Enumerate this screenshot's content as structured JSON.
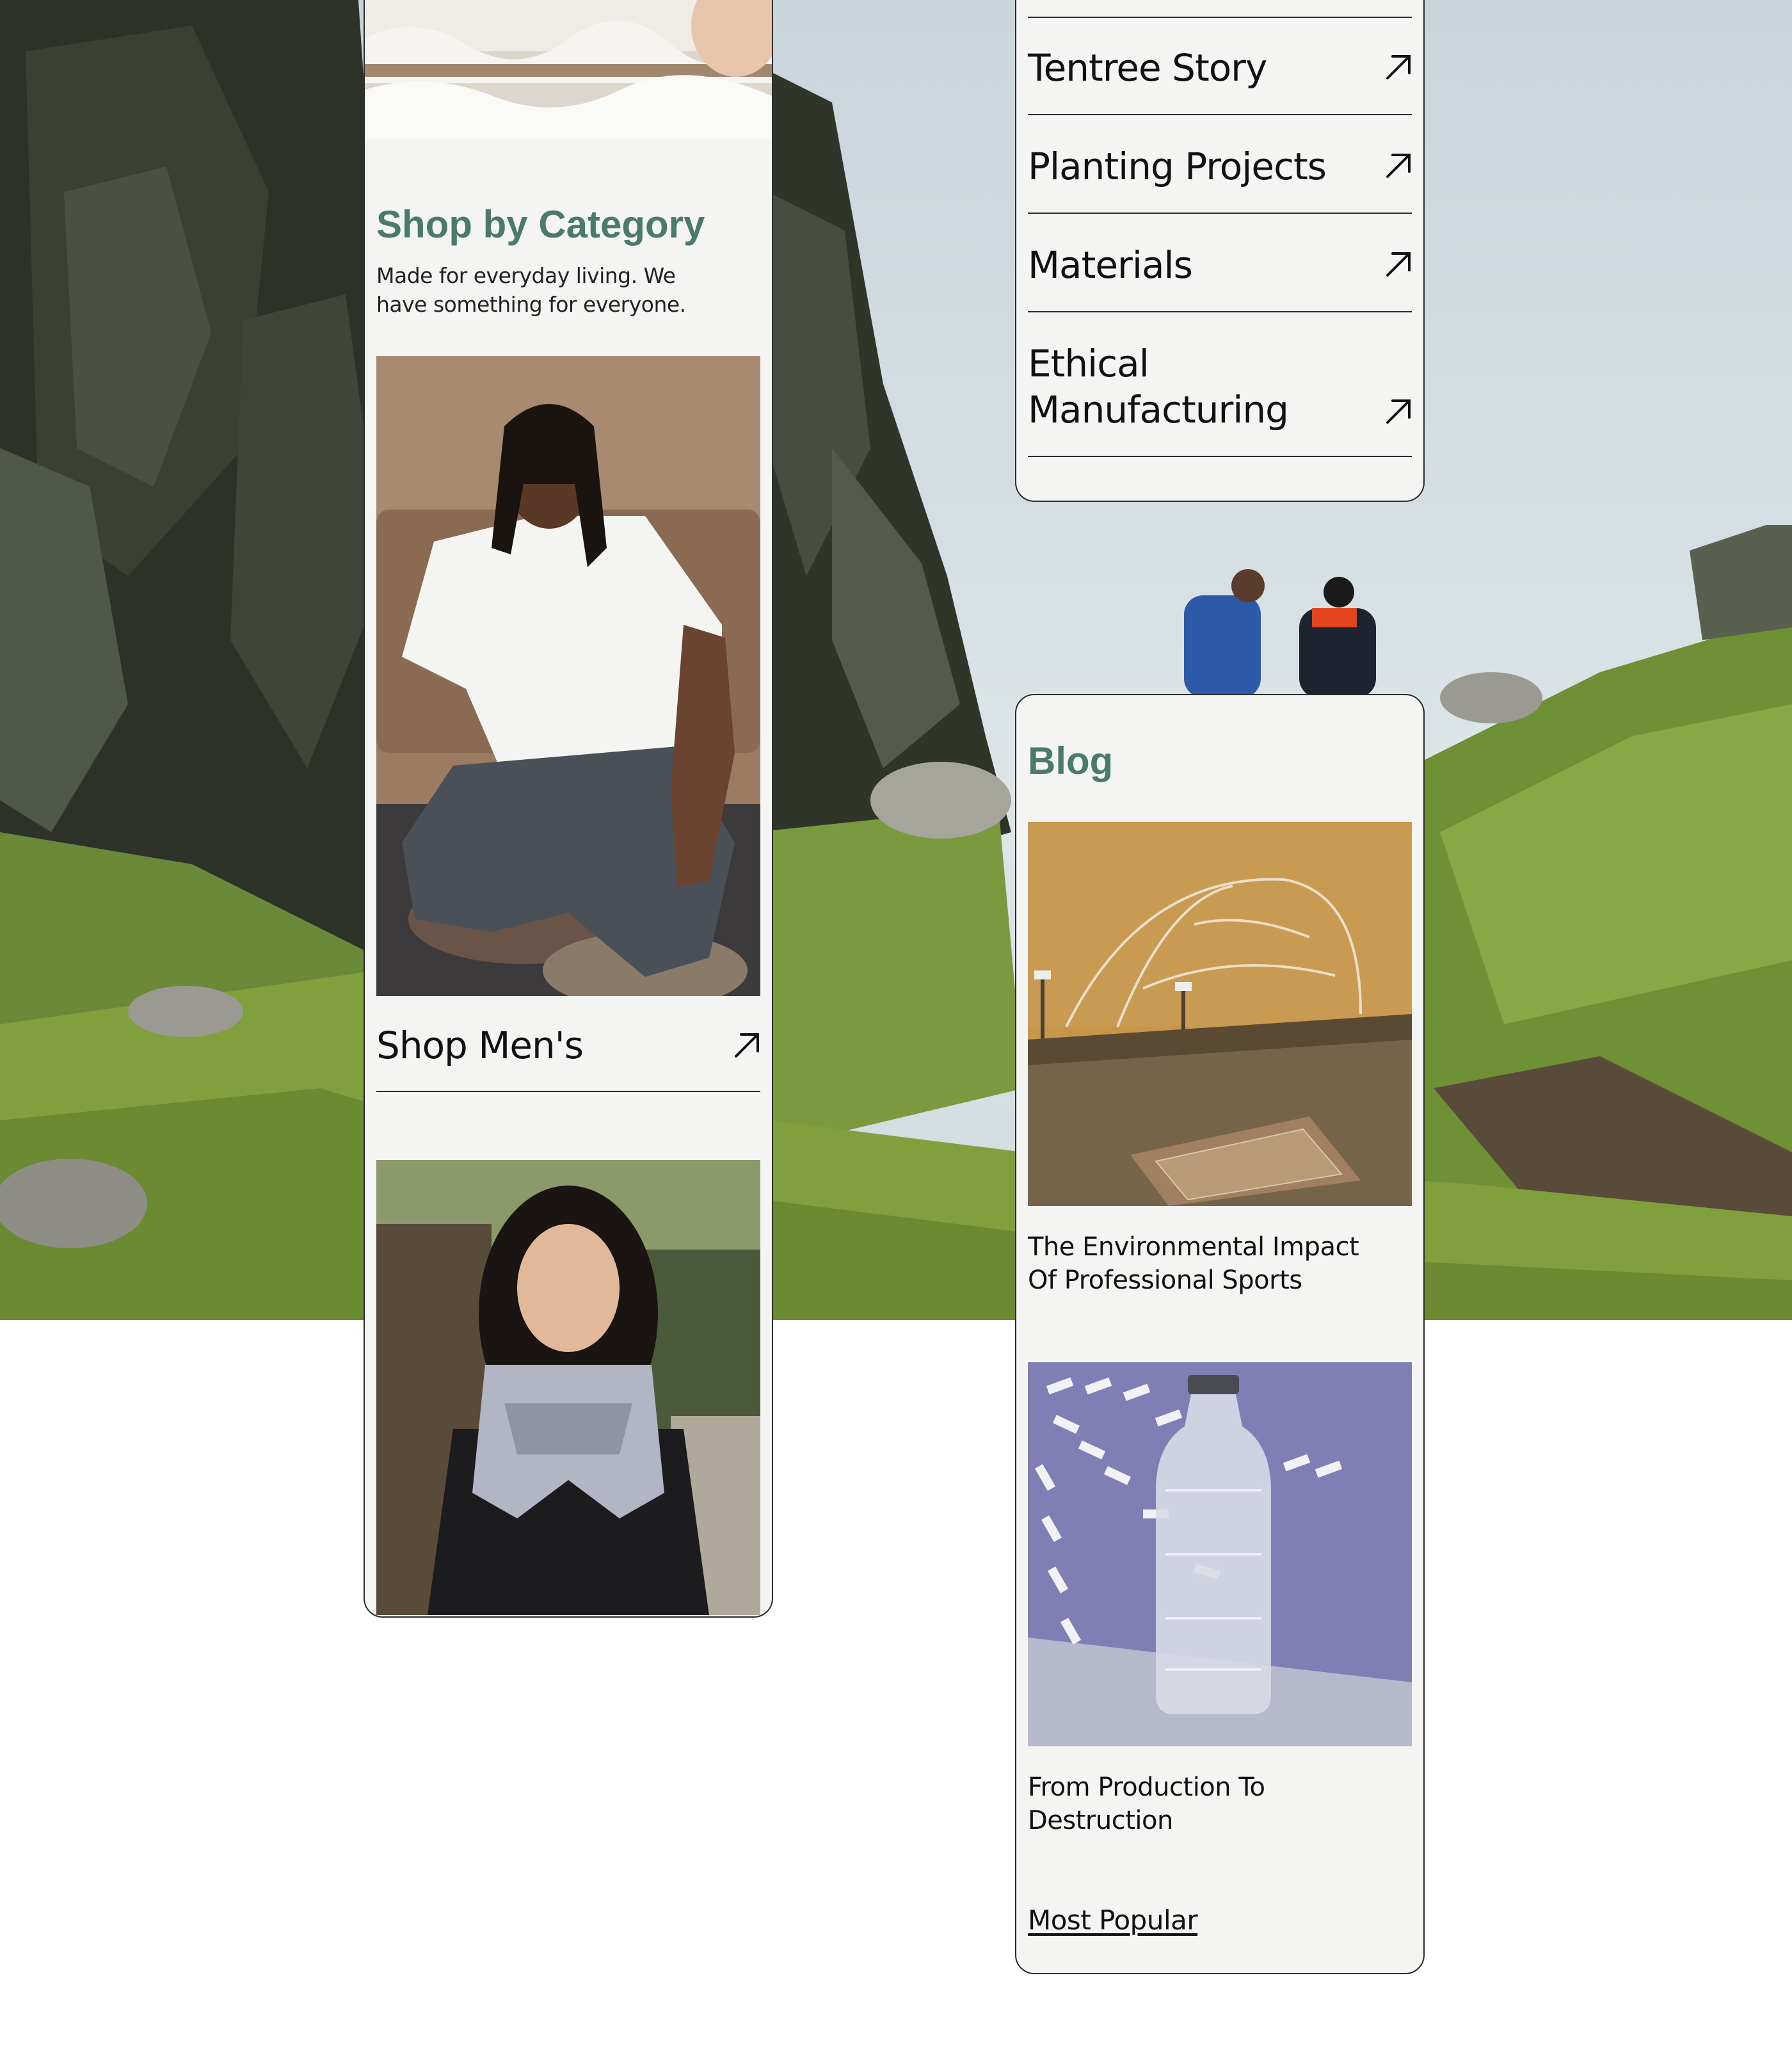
{
  "shop": {
    "heading": "Shop by Category",
    "description_line1": "Made for everyday living. We",
    "description_line2": "have something for everyone.",
    "mens_label": "Shop Men's"
  },
  "about_menu": {
    "items": [
      {
        "label": "Tentree Story"
      },
      {
        "label": "Planting Projects"
      },
      {
        "label": "Materials"
      },
      {
        "label_line1": "Ethical",
        "label_line2": "Manufacturing"
      }
    ]
  },
  "blog": {
    "heading": "Blog",
    "posts": [
      {
        "title_line1": "The Environmental Impact",
        "title_line2": "Of Professional Sports"
      },
      {
        "title_line1": "From Production To",
        "title_line2": "Destruction"
      }
    ],
    "most_popular": "Most Popular"
  },
  "colors": {
    "accent_green": "#4a7a6a",
    "panel_bg": "#f4f4f2",
    "border": "#2b2b2b"
  },
  "icons": {
    "row_arrow": "arrow-up-right-icon"
  }
}
